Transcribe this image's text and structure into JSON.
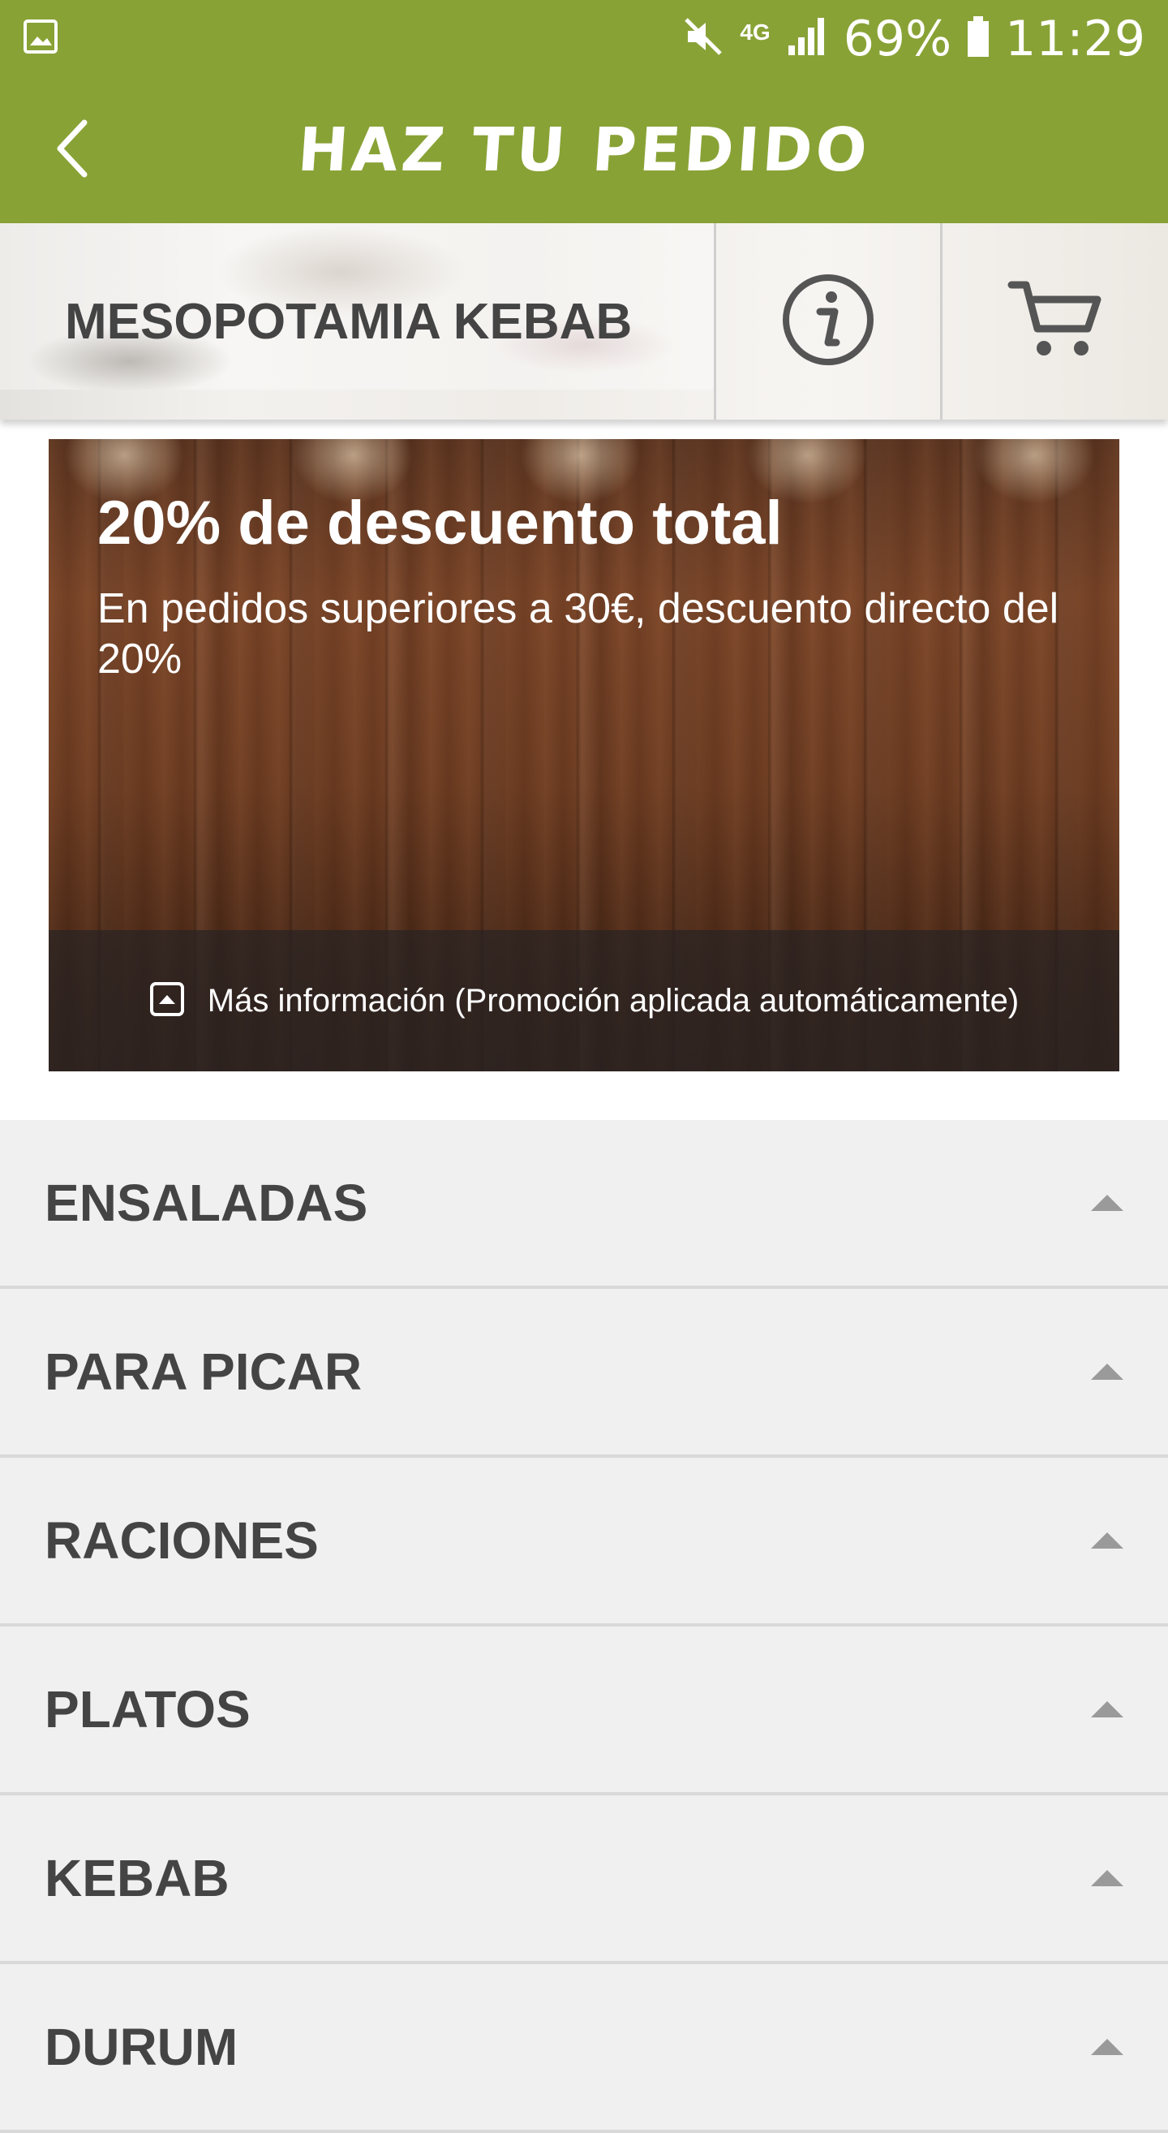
{
  "status_bar": {
    "network_type": "4G",
    "battery": "69%",
    "time": "11:29",
    "icons": [
      "gallery-icon",
      "mute-icon",
      "signal-icon",
      "battery-icon"
    ]
  },
  "app_bar": {
    "title": "HAZ TU PEDIDO",
    "back_icon": "chevron-left-icon"
  },
  "restaurant": {
    "name": "MESOPOTAMIA KEBAB",
    "info_icon": "info-icon",
    "cart_icon": "cart-icon"
  },
  "promo": {
    "title": "20% de descuento total",
    "description": "En pedidos superiores a 30€, descuento directo del 20%",
    "more_info": "Más información (Promoción aplicada automáticamente)",
    "more_info_icon": "expand-up-icon"
  },
  "categories": [
    {
      "label": "ENSALADAS"
    },
    {
      "label": "PARA PICAR"
    },
    {
      "label": "RACIONES"
    },
    {
      "label": "PLATOS"
    },
    {
      "label": "KEBAB"
    },
    {
      "label": "DURUM"
    }
  ],
  "colors": {
    "primary": "#89a236",
    "text_dark": "#444444",
    "row_bg": "#f0f0f0"
  }
}
